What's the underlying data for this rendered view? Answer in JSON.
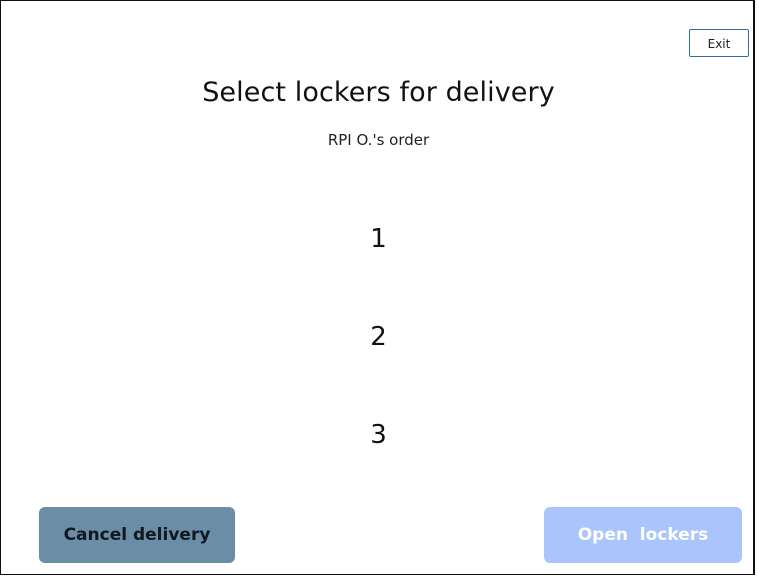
{
  "header": {
    "exit_label": "Exit"
  },
  "main": {
    "title": "Select lockers for delivery",
    "subtitle": "RPI O.'s order",
    "lockers": [
      {
        "label": "1"
      },
      {
        "label": "2"
      },
      {
        "label": "3"
      }
    ]
  },
  "footer": {
    "cancel_label": "Cancel delivery",
    "open_label": "Open  lockers",
    "open_enabled": false
  },
  "colors": {
    "cancel_button_bg": "#6b8ea6",
    "open_button_bg_disabled": "#a9c5fb",
    "exit_button_border": "#2f6ab3"
  }
}
